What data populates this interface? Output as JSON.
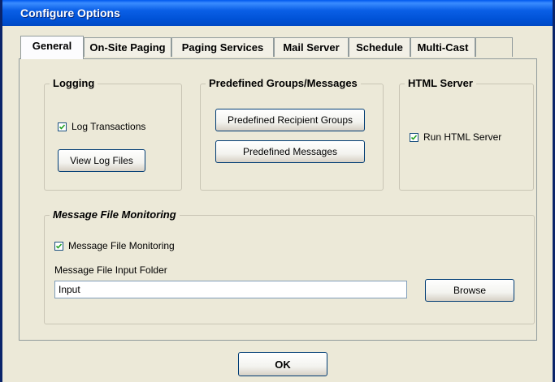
{
  "window": {
    "title": "Configure Options"
  },
  "tabs": [
    {
      "label": "General",
      "active": true
    },
    {
      "label": "On-Site Paging",
      "active": false
    },
    {
      "label": "Paging Services",
      "active": false
    },
    {
      "label": "Mail Server",
      "active": false
    },
    {
      "label": "Schedule",
      "active": false
    },
    {
      "label": "Multi-Cast",
      "active": false
    },
    {
      "label": "",
      "active": false
    }
  ],
  "logging": {
    "title": "Logging",
    "log_transactions_label": "Log Transactions",
    "log_transactions_checked": true,
    "view_log_files_label": "View Log Files"
  },
  "predefined": {
    "title": "Predefined Groups/Messages",
    "recipient_groups_label": "Predefined Recipient Groups",
    "messages_label": "Predefined Messages"
  },
  "html_server": {
    "title": "HTML Server",
    "run_label": "Run HTML Server",
    "run_checked": true
  },
  "monitoring": {
    "title": "Message File Monitoring",
    "checkbox_label": "Message File Monitoring",
    "checkbox_checked": true,
    "folder_label": "Message File Input Folder",
    "folder_value": "Input",
    "browse_label": "Browse"
  },
  "footer": {
    "ok_label": "OK"
  }
}
